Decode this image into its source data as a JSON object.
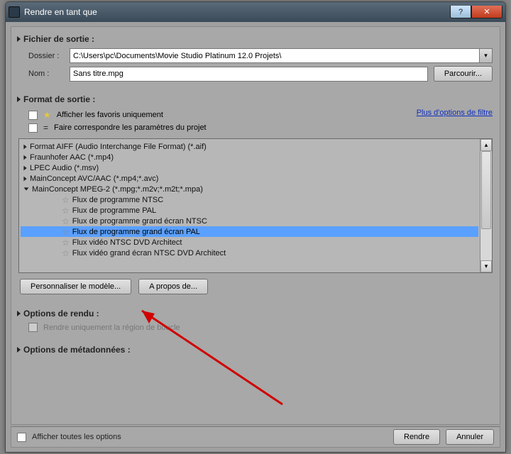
{
  "window": {
    "title": "Rendre en tant que"
  },
  "output_file": {
    "header": "Fichier de sortie :",
    "folder_label": "Dossier :",
    "folder_value": "C:\\Users\\pc\\Documents\\Movie Studio Platinum 12.0 Projets\\",
    "name_label": "Nom :",
    "name_value": "Sans titre.mpg",
    "browse": "Parcourir..."
  },
  "format": {
    "header": "Format de sortie :",
    "show_fav": "Afficher les favoris uniquement",
    "match_project": "Faire correspondre les paramètres du projet",
    "more_filters": "Plus d'options de filtre",
    "items": [
      "Format AIFF (Audio Interchange File Format) (*.aif)",
      "Fraunhofer AAC (*.mp4)",
      "LPEC Audio (*.msv)",
      "MainConcept AVC/AAC (*.mp4;*.avc)",
      "MainConcept MPEG-2 (*.mpg;*.m2v;*.m2t;*.mpa)"
    ],
    "children": [
      "Flux de programme NTSC",
      "Flux de programme PAL",
      "Flux de programme grand écran NTSC",
      "Flux de programme grand écran PAL",
      "Flux vidéo NTSC DVD Architect",
      "Flux vidéo grand écran NTSC DVD Architect"
    ],
    "selected_index": 3,
    "customize": "Personnaliser le modèle...",
    "about": "A propos de..."
  },
  "render_options": {
    "header": "Options de rendu :",
    "loop_only": "Rendre uniquement la région de boucle"
  },
  "metadata": {
    "header": "Options de métadonnées :"
  },
  "footer": {
    "show_all": "Afficher toutes les options",
    "render": "Rendre",
    "cancel": "Annuler"
  }
}
